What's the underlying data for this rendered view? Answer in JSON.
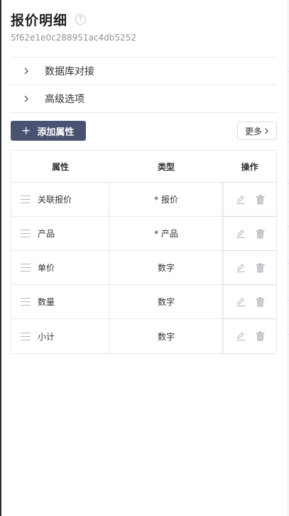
{
  "header": {
    "title": "报价明细",
    "record_id": "5f62e1e0c288951ac4db5252",
    "help_icon": "?"
  },
  "collapse": [
    {
      "label": "数据库对接"
    },
    {
      "label": "高级选项"
    }
  ],
  "toolbar": {
    "add_label": "添加属性",
    "add_icon": "+",
    "more_label": "更多"
  },
  "table": {
    "columns": [
      "属性",
      "类型",
      "操作"
    ],
    "rows": [
      {
        "name": "关联报价",
        "type": "* 报价"
      },
      {
        "name": "产品",
        "type": "* 产品"
      },
      {
        "name": "单价",
        "type": "数字"
      },
      {
        "name": "数量",
        "type": "数字"
      },
      {
        "name": "小计",
        "type": "数字"
      }
    ]
  },
  "colors": {
    "primary_button": "#4a5272",
    "border": "#e4e7ed",
    "muted_text": "#909399",
    "icon_gray": "#b5b8bf"
  }
}
